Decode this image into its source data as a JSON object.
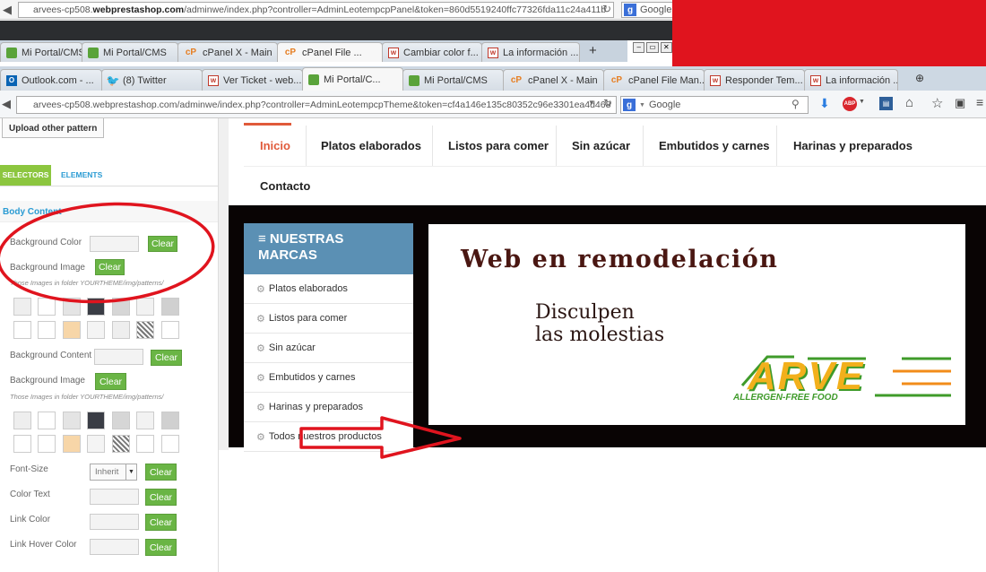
{
  "top_browser": {
    "url_host": "arvees-cp508.",
    "url_bold": "webprestashop.com",
    "url_path": "/adminwe/index.php?controller=AdminLeotempcpPanel&token=860d5519240ffc77326fda11c24a411b",
    "search_label": "Google",
    "tabs": [
      {
        "label": "Mi Portal/CMS",
        "icon": "green"
      },
      {
        "label": "Mi Portal/CMS",
        "icon": "green"
      },
      {
        "label": "cPanel X - Main",
        "icon": "cp"
      },
      {
        "label": "cPanel File ...",
        "icon": "cp"
      },
      {
        "label": "Cambiar color f...",
        "icon": "w"
      },
      {
        "label": "La información ...",
        "icon": "w"
      }
    ],
    "new_tab": "+"
  },
  "main_browser": {
    "tabs": [
      {
        "label": "Outlook.com - ...",
        "icon": "ol"
      },
      {
        "label": "(8) Twitter",
        "icon": "tw"
      },
      {
        "label": "Ver Ticket - web...",
        "icon": "w"
      },
      {
        "label": "Mi Portal/C...",
        "icon": "green"
      },
      {
        "label": "Mi Portal/CMS",
        "icon": "green"
      },
      {
        "label": "cPanel X - Main",
        "icon": "cp"
      },
      {
        "label": "cPanel File Man...",
        "icon": "cp"
      },
      {
        "label": "Responder Tem...",
        "icon": "w"
      },
      {
        "label": "La información ...",
        "icon": "w"
      }
    ],
    "url_text": "arvees-cp508.webprestashop.com/adminwe/index.php?controller=AdminLeotempcpTheme&token=cf4a146e135c80352c96e3301ea4d468",
    "search_label": "Google"
  },
  "panel": {
    "upload_button": "Upload other pattern",
    "tab_selectors": "SELECTORS",
    "tab_elements": "ELEMENTS",
    "section_title": "Body Content",
    "bg_color_label": "Background Color",
    "bg_image_label": "Background Image",
    "patterns_note_1": "Those Images in folder YOURTHEME/img/patterns/",
    "bg_content_label": "Background Content",
    "bg_image_label_2": "Background Image",
    "patterns_note_2": "Those Images in folder YOURTHEME/img/patterns/",
    "font_size_label": "Font-Size",
    "font_size_value": "Inherit",
    "color_text_label": "Color Text",
    "link_color_label": "Link Color",
    "link_hover_label": "Link Hover Color",
    "clear_label": "Clear"
  },
  "site": {
    "nav": [
      "Inicio",
      "Platos elaborados",
      "Listos para comer",
      "Sin azúcar",
      "Embutidos y carnes",
      "Harinas y preparados",
      "Contacto"
    ],
    "brands_title_1": "NUESTRAS",
    "brands_title_2": "MARCAS",
    "brands": [
      "Platos elaborados",
      "Listos para comer",
      "Sin azúcar",
      "Embutidos y carnes",
      "Harinas y preparados",
      "Todos nuestros productos"
    ],
    "banner_line1": "Web en remodelación",
    "banner_line2": "Disculpen",
    "banner_line3": "las molestias",
    "logo_text": "ARVE",
    "logo_sub": "ALLERGEN-FREE FOOD"
  },
  "colors": {
    "accent_green": "#6ab545",
    "selector_tab": "#8cc63f",
    "brand_header": "#5b90b4",
    "annotation_red": "#e0141e",
    "nav_active": "#e05a3a"
  }
}
